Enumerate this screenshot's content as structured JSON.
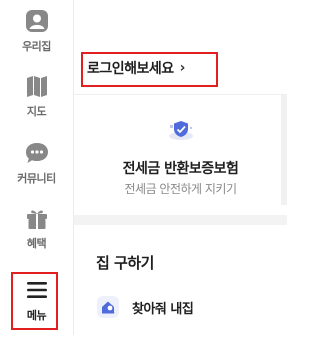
{
  "sidebar": {
    "items": [
      {
        "label": "우리집",
        "icon": "person-icon"
      },
      {
        "label": "지도",
        "icon": "map-icon"
      },
      {
        "label": "커뮤니티",
        "icon": "chat-bubble-icon"
      },
      {
        "label": "혜택",
        "icon": "gift-icon"
      },
      {
        "label": "메뉴",
        "icon": "menu-icon"
      }
    ]
  },
  "main": {
    "login_label": "로그인해보세요",
    "login_chevron": "›",
    "insurance": {
      "title": "전세금 반환보증보험",
      "subtitle": "전세금 안전하게 지키기"
    },
    "section_title": "집 구하기",
    "find_item_label": "찾아줘 내집"
  },
  "colors": {
    "highlight": "#e32020",
    "accent_blue": "#4f6bdc"
  }
}
